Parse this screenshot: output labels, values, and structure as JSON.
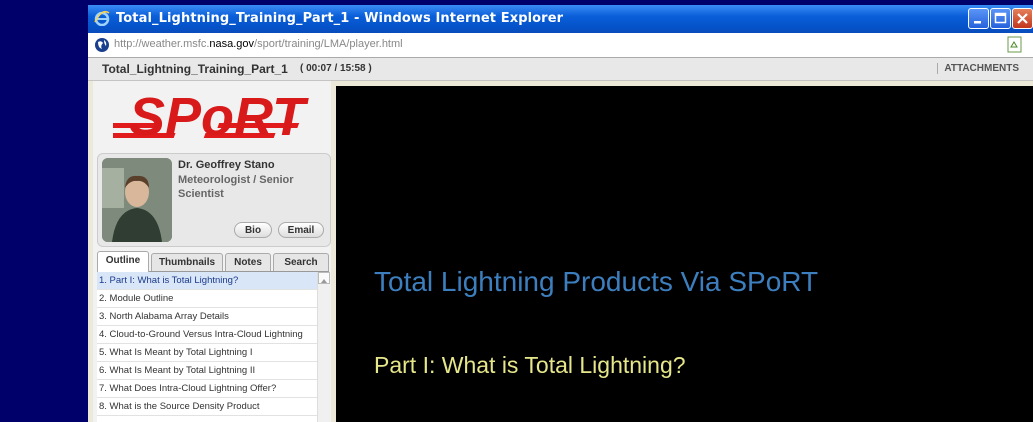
{
  "window": {
    "title": "Total_Lightning_Training_Part_1 - Windows Internet Explorer",
    "url_prefix": "http://weather.msfc.",
    "url_domain": "nasa.gov",
    "url_suffix": "/sport/training/LMA/player.html"
  },
  "player": {
    "presentation_title": "Total_Lightning_Training_Part_1",
    "time": "( 00:07 / 15:58 )",
    "attachments_label": "ATTACHMENTS",
    "logo_text": "SPoRT"
  },
  "presenter": {
    "name": "Dr. Geoffrey Stano",
    "role": "Meteorologist / Senior Scientist",
    "bio_label": "Bio",
    "email_label": "Email"
  },
  "tabs": [
    {
      "label": "Outline"
    },
    {
      "label": "Thumbnails"
    },
    {
      "label": "Notes"
    },
    {
      "label": "Search"
    }
  ],
  "outline": [
    {
      "label": "1. Part I: What is Total Lightning?"
    },
    {
      "label": "2. Module Outline"
    },
    {
      "label": "3. North Alabama Array Details"
    },
    {
      "label": "4. Cloud-to-Ground Versus Intra-Cloud Lightning"
    },
    {
      "label": "5. What Is Meant by Total Lightning I"
    },
    {
      "label": "6. What Is Meant by Total Lightning II"
    },
    {
      "label": "7. What Does Intra-Cloud Lightning Offer?"
    },
    {
      "label": "8. What is the Source Density Product"
    }
  ],
  "slide": {
    "title": "Total Lightning Products Via SPoRT",
    "subtitle": "Part I: What is Total Lightning?"
  }
}
